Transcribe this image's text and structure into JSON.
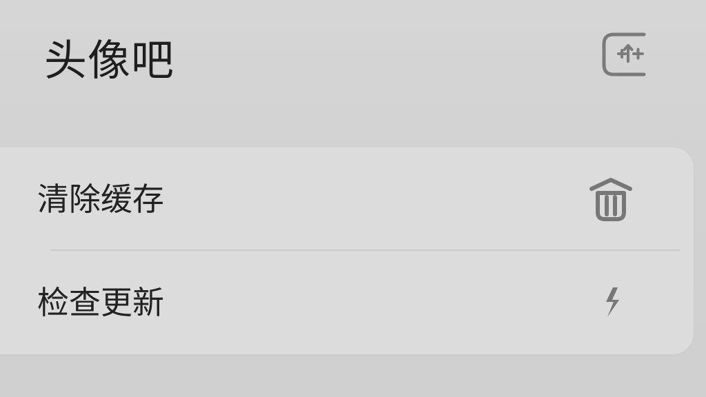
{
  "header": {
    "title": "头像吧",
    "action_icon": "add-frame-icon"
  },
  "settings": {
    "items": [
      {
        "label": "清除缓存",
        "icon": "trash-icon"
      },
      {
        "label": "检查更新",
        "icon": "lightning-icon"
      }
    ]
  },
  "colors": {
    "background": "#d3d3d3",
    "card": "#dcdcdc",
    "text": "#1e1e1e",
    "icon": "#777777",
    "divider": "#c9c9c9"
  }
}
